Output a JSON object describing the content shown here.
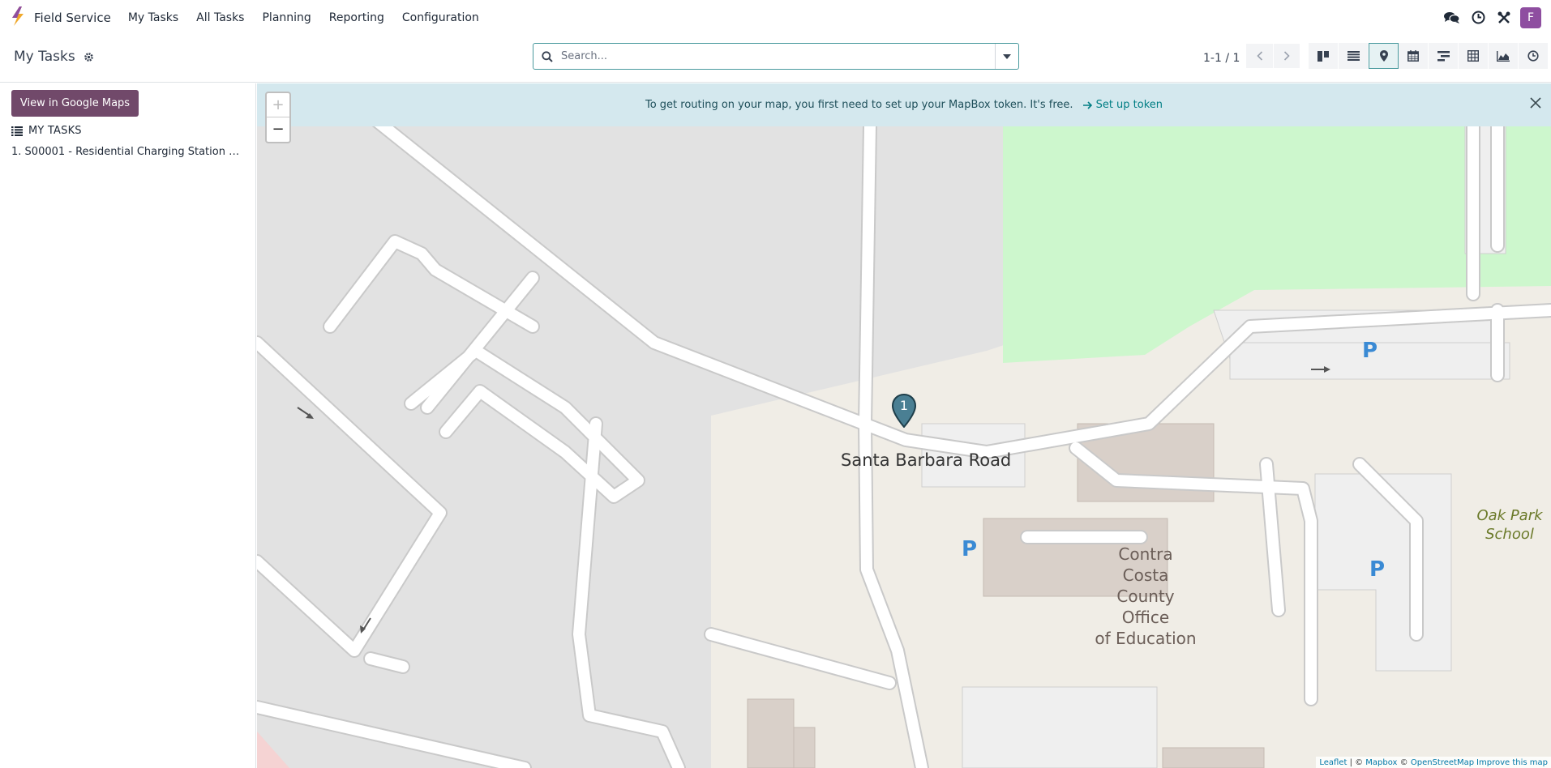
{
  "navbar": {
    "app_name": "Field Service",
    "menu": [
      {
        "label": "My Tasks"
      },
      {
        "label": "All Tasks"
      },
      {
        "label": "Planning"
      },
      {
        "label": "Reporting"
      },
      {
        "label": "Configuration"
      }
    ],
    "avatar_initial": "F",
    "avatar_color": "#8e4ea0"
  },
  "control": {
    "title": "My Tasks",
    "search_placeholder": "Search...",
    "pager": "1-1 / 1",
    "views": [
      "kanban",
      "list",
      "map",
      "calendar",
      "gantt",
      "pivot",
      "graph",
      "activity"
    ],
    "active_view": "map"
  },
  "sidebar": {
    "google_maps_button": "View in Google Maps",
    "list_title": "MY TASKS",
    "tasks": [
      {
        "index": "1.",
        "name": "S00001 - Residential Charging Station Ce..."
      }
    ]
  },
  "map": {
    "alert_text": "To get routing on your map, you first need to set up your MapBox token. It's free.",
    "alert_link": "Set up token",
    "zoom_in": "+",
    "zoom_out": "−",
    "marker_number": "1",
    "labels": {
      "road": "Santa Barbara Road",
      "building_lines": [
        "Contra",
        "Costa",
        "County",
        "Office",
        "of Education"
      ],
      "school_lines": [
        "Oak Park",
        "School"
      ],
      "parking": "P"
    },
    "attribution": {
      "leaflet": "Leaflet",
      "sep1": " | © ",
      "mapbox": "Mapbox",
      "sep2": " © ",
      "osm": "OpenStreetMap",
      "improve": "Improve this map"
    }
  },
  "colors": {
    "brand_button": "#71496a",
    "accent": "#017e84",
    "alert_bg": "#d4e8ee",
    "marker": "#4a7f93"
  }
}
